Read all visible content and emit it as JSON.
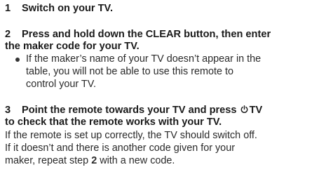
{
  "steps": [
    {
      "number": "1",
      "heading_lines": [
        "Switch on your TV."
      ]
    },
    {
      "number": "2",
      "heading_lines": [
        "Press and hold down the CLEAR button, then enter",
        "the maker code for your TV."
      ],
      "bullet_lines": [
        "If the maker’s name of your TV doesn’t appear in the",
        "table, you will not be able to use this remote to",
        "control your TV."
      ]
    },
    {
      "number": "3",
      "heading_line1_before_icon": "Point the remote towards your TV and press",
      "heading_line1_after_icon": "TV",
      "heading_line2": "to check that the remote works with your TV.",
      "body_lines": [
        "If the remote is set up correctly, the TV should switch off.",
        "If it doesn’t and there is another code given for your"
      ],
      "body_line3_before": "maker, repeat step ",
      "body_line3_bold": "2",
      "body_line3_after": " with a new code."
    }
  ],
  "icons": {
    "power": "power-icon"
  }
}
